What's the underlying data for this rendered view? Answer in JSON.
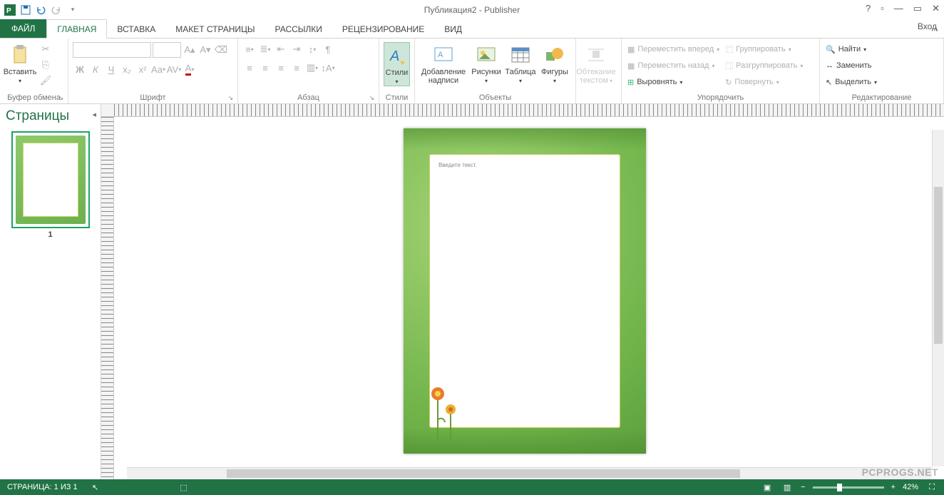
{
  "app": {
    "title": "Публикация2 - Publisher",
    "login": "Вход"
  },
  "window_controls": {
    "help": "?",
    "minimize": "—",
    "maximize": "▭",
    "close": "✕"
  },
  "tabs": {
    "file": "ФАЙЛ",
    "items": [
      "ГЛАВНАЯ",
      "ВСТАВКА",
      "МАКЕТ СТРАНИЦЫ",
      "РАССЫЛКИ",
      "РЕЦЕНЗИРОВАНИЕ",
      "ВИД"
    ],
    "active_index": 0
  },
  "ribbon": {
    "clipboard": {
      "paste": "Вставить",
      "label": "Буфер обмена"
    },
    "font": {
      "label": "Шрифт",
      "bold": "Ж",
      "italic": "К",
      "underline": "Ч",
      "sub": "x₂",
      "sup": "x²",
      "case": "Aa",
      "spacing": "AV",
      "color": "A"
    },
    "paragraph": {
      "label": "Абзац"
    },
    "styles": {
      "label": "Стили",
      "btn": "Стили"
    },
    "objects": {
      "label": "Объекты",
      "textbox": "Добавление\nнадписи",
      "pictures": "Рисунки",
      "table": "Таблица",
      "shapes": "Фигуры"
    },
    "wrap": {
      "label": "",
      "btn": "Обтекание\nтекстом"
    },
    "arrange": {
      "label": "Упорядочить",
      "forward": "Переместить вперед",
      "backward": "Переместить назад",
      "align": "Выровнять",
      "group": "Группировать",
      "ungroup": "Разгруппировать",
      "rotate": "Повернуть"
    },
    "editing": {
      "label": "Редактирование",
      "find": "Найти",
      "replace": "Заменить",
      "select": "Выделить"
    }
  },
  "pages": {
    "title": "Страницы",
    "items": [
      {
        "number": "1"
      }
    ]
  },
  "document": {
    "placeholder_text": "Введите текст."
  },
  "statusbar": {
    "page": "СТРАНИЦА: 1 ИЗ 1",
    "zoom": "42%"
  },
  "watermark": "PCPROGS.NET"
}
